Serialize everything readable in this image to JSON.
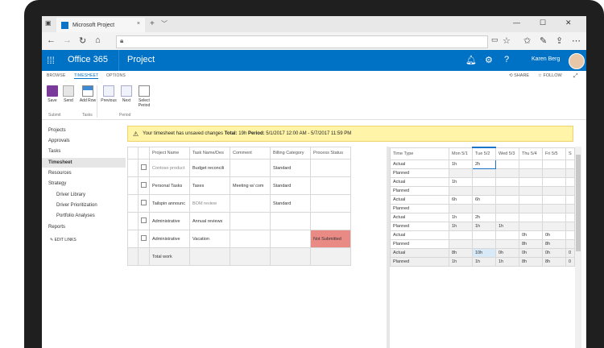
{
  "browser": {
    "tab_title": "Microsoft Project",
    "tab_close": "×",
    "new_tab": "+",
    "tab_list": "﹀",
    "win_min": "—",
    "win_max": "☐",
    "win_close": "✕"
  },
  "header": {
    "suite": "Office 365",
    "app": "Project",
    "user": "Karen Berg"
  },
  "ribbon_tabs": {
    "browse": "BROWSE",
    "timesheet": "TIMESHEET",
    "options": "OPTIONS",
    "share": "SHARE",
    "follow": "FOLLOW"
  },
  "ribbon": {
    "save": "Save",
    "send": "Send",
    "add_row": "Add Row",
    "previous": "Previous",
    "next": "Next",
    "select_period": "Select Period",
    "grp_submit": "Submit",
    "grp_tasks": "Tasks",
    "grp_period": "Period"
  },
  "nav": {
    "projects": "Projects",
    "approvals": "Approvals",
    "tasks": "Tasks",
    "timesheet": "Timesheet",
    "resources": "Resources",
    "strategy": "Strategy",
    "driver_library": "Driver Library",
    "driver_prior": "Driver Prioritization",
    "portfolio": "Portfolio Analyses",
    "reports": "Reports",
    "edit_links": "EDIT LINKS"
  },
  "warning": {
    "text": "Your timesheet has unsaved changes",
    "total_label": "Total:",
    "total_value": "19h",
    "period_label": "Period:",
    "period_value": "5/1/2017 12:00 AM - 5/7/2017 11:59 PM"
  },
  "grid": {
    "headers": [
      "Project Name",
      "Task Name/Des",
      "Comment",
      "Billing Category",
      "Process Status"
    ],
    "rows": [
      [
        "Contoso product",
        "Budget reconcili",
        "",
        "Standard",
        ""
      ],
      [
        "Personal Tasks",
        "Taxes",
        "Meeting w/ com",
        "Standard",
        ""
      ],
      [
        "Tailspin announc",
        "BOM review",
        "",
        "Standard",
        ""
      ],
      [
        "Administrative",
        "Annual reviews",
        "",
        "",
        ""
      ],
      [
        "Administrative",
        "Vacation",
        "",
        "",
        "Not Submitted"
      ]
    ],
    "total": "Total work"
  },
  "timegrid": {
    "headers": [
      "Time Type",
      "Mon 5/1",
      "Tue 5/2",
      "Wed 5/3",
      "Thu 5/4",
      "Fri 5/5",
      "S"
    ],
    "rows": [
      [
        "Actual",
        "1h",
        "2h",
        "",
        "",
        "",
        ""
      ],
      [
        "Planned",
        "",
        "",
        "",
        "",
        "",
        ""
      ],
      [
        "Actual",
        "1h",
        "",
        "",
        "",
        "",
        ""
      ],
      [
        "Planned",
        "",
        "",
        "",
        "",
        "",
        ""
      ],
      [
        "Actual",
        "6h",
        "6h",
        "",
        "",
        "",
        ""
      ],
      [
        "Planned",
        "",
        "",
        "",
        "",
        "",
        ""
      ],
      [
        "Actual",
        "1h",
        "2h",
        "",
        "",
        "",
        ""
      ],
      [
        "Planned",
        "1h",
        "1h",
        "1h",
        "",
        "",
        ""
      ],
      [
        "Actual",
        "",
        "",
        "",
        "0h",
        "0h",
        ""
      ],
      [
        "Planned",
        "",
        "",
        "",
        "8h",
        "8h",
        ""
      ],
      [
        "Actual",
        "8h",
        "10h",
        "0h",
        "0h",
        "0h",
        "0"
      ],
      [
        "Planned",
        "1h",
        "1h",
        "1h",
        "8h",
        "8h",
        "0"
      ]
    ]
  }
}
